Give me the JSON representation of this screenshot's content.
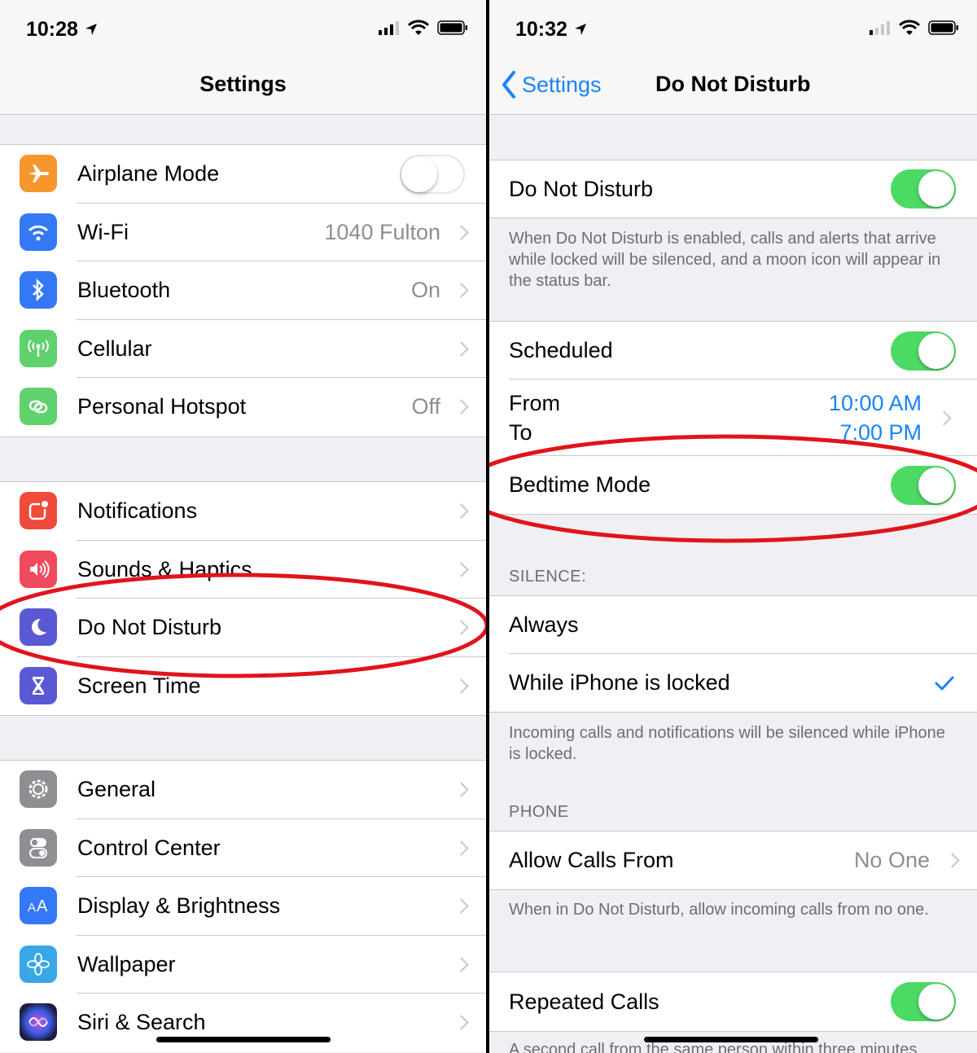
{
  "left": {
    "status": {
      "time": "10:28"
    },
    "title": "Settings",
    "groups": [
      {
        "items": [
          {
            "label": "Airplane Mode",
            "value": "",
            "icon": "airplane-icon",
            "color": "#f7962c"
          },
          {
            "label": "Wi-Fi",
            "value": "1040 Fulton",
            "icon": "wifi-icon",
            "color": "#3478f6"
          },
          {
            "label": "Bluetooth",
            "value": "On",
            "icon": "bluetooth-icon",
            "color": "#3478f6"
          },
          {
            "label": "Cellular",
            "value": "",
            "icon": "antenna-icon",
            "color": "#5fd26c"
          },
          {
            "label": "Personal Hotspot",
            "value": "Off",
            "icon": "hotspot-icon",
            "color": "#5fd26c"
          }
        ]
      },
      {
        "items": [
          {
            "label": "Notifications",
            "value": "",
            "icon": "notifications-icon",
            "color": "#ef4a3c"
          },
          {
            "label": "Sounds & Haptics",
            "value": "",
            "icon": "speaker-icon",
            "color": "#ef4a5e"
          },
          {
            "label": "Do Not Disturb",
            "value": "",
            "icon": "moon-icon",
            "color": "#5b58d6"
          },
          {
            "label": "Screen Time",
            "value": "",
            "icon": "hourglass-icon",
            "color": "#5b58d6"
          }
        ]
      },
      {
        "items": [
          {
            "label": "General",
            "value": "",
            "icon": "gear-icon",
            "color": "#8e8e93"
          },
          {
            "label": "Control Center",
            "value": "",
            "icon": "switches-icon",
            "color": "#8e8e93"
          },
          {
            "label": "Display & Brightness",
            "value": "",
            "icon": "text-size-icon",
            "color": "#3478f6"
          },
          {
            "label": "Wallpaper",
            "value": "",
            "icon": "flower-icon",
            "color": "#3aa6e8"
          },
          {
            "label": "Siri & Search",
            "value": "",
            "icon": "siri-icon",
            "color": "#1c1c3c"
          }
        ]
      }
    ]
  },
  "right": {
    "status": {
      "time": "10:32"
    },
    "back_label": "Settings",
    "title": "Do Not Disturb",
    "dnd_label": "Do Not Disturb",
    "dnd_footer": "When Do Not Disturb is enabled, calls and alerts that arrive while locked will be silenced, and a moon icon will appear in the status bar.",
    "scheduled_label": "Scheduled",
    "from_label": "From",
    "to_label": "To",
    "from_time": "10:00 AM",
    "to_time": "7:00 PM",
    "bedtime_label": "Bedtime Mode",
    "silence_header": "SILENCE:",
    "always_label": "Always",
    "locked_label": "While iPhone is locked",
    "silence_footer": "Incoming calls and notifications will be silenced while iPhone is locked.",
    "phone_header": "PHONE",
    "allow_calls_label": "Allow Calls From",
    "allow_calls_value": "No One",
    "allow_footer": "When in Do Not Disturb, allow incoming calls from no one.",
    "repeated_label": "Repeated Calls",
    "repeated_footer": "A second call from the same person within three minutes"
  },
  "colors": {
    "accent": "#1a82fb",
    "toggle_on": "#4cd964",
    "annotation": "#e0141c"
  }
}
